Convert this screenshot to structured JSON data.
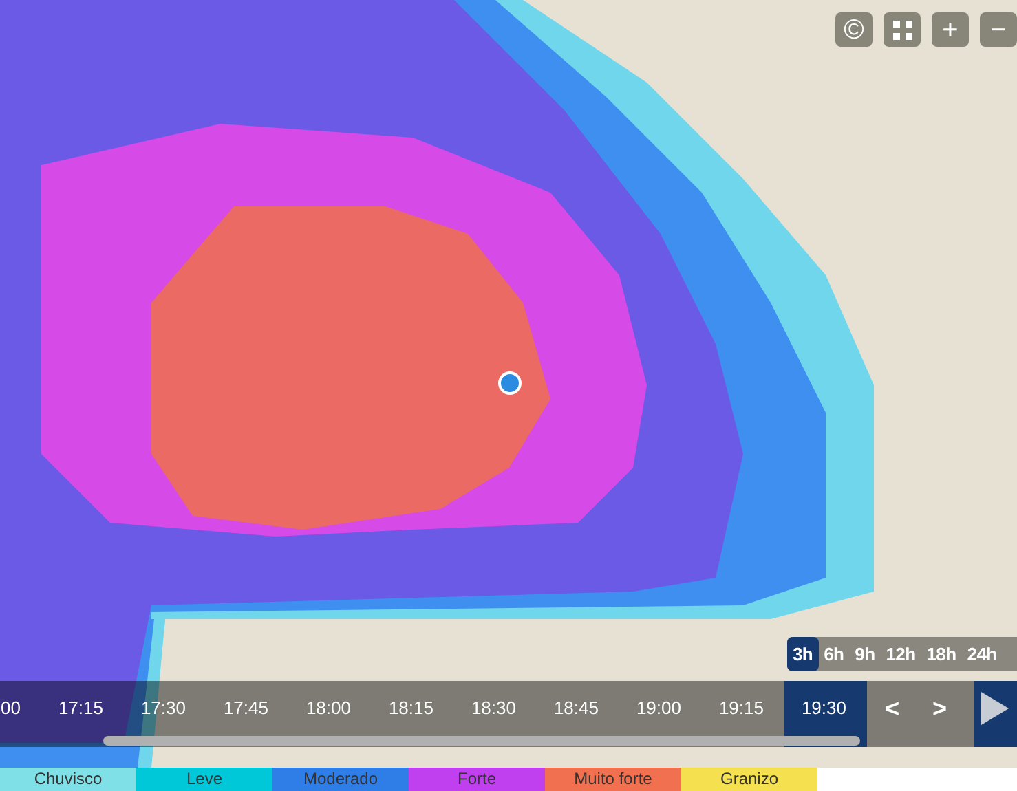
{
  "map_controls": [
    {
      "kind": "copyright",
      "label": "©"
    },
    {
      "kind": "fullscreen"
    },
    {
      "kind": "zoom_in",
      "label": "+"
    },
    {
      "kind": "zoom_out",
      "label": "−"
    }
  ],
  "ranges": [
    {
      "label": "3h",
      "selected": true
    },
    {
      "label": "6h",
      "selected": false
    },
    {
      "label": "9h",
      "selected": false
    },
    {
      "label": "12h",
      "selected": false
    },
    {
      "label": "18h",
      "selected": false
    },
    {
      "label": "24h",
      "selected": false
    }
  ],
  "timeline": {
    "times": [
      {
        "label": "00",
        "selected": false
      },
      {
        "label": "17:15",
        "selected": false
      },
      {
        "label": "17:30",
        "selected": false
      },
      {
        "label": "17:45",
        "selected": false
      },
      {
        "label": "18:00",
        "selected": false
      },
      {
        "label": "18:15",
        "selected": false
      },
      {
        "label": "18:30",
        "selected": false
      },
      {
        "label": "18:45",
        "selected": false
      },
      {
        "label": "19:00",
        "selected": false
      },
      {
        "label": "19:15",
        "selected": false
      },
      {
        "label": "19:30",
        "selected": true
      }
    ],
    "prev": "<",
    "next": ">"
  },
  "legend": [
    {
      "label": "Chuvisco",
      "color": "#7fe0e8"
    },
    {
      "label": "Leve",
      "color": "#00c8d8"
    },
    {
      "label": "Moderado",
      "color": "#2f7de6"
    },
    {
      "label": "Forte",
      "color": "#c040f0"
    },
    {
      "label": "Muito forte",
      "color": "#f07050"
    },
    {
      "label": "Granizo",
      "color": "#f5e050"
    }
  ]
}
